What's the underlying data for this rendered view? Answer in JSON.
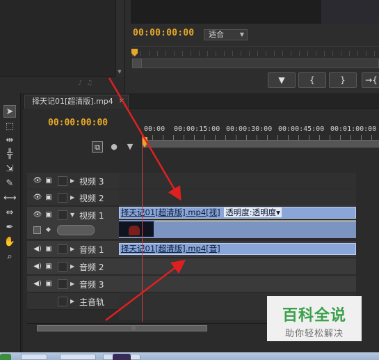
{
  "program_monitor": {
    "timecode": "00:00:00:00",
    "fit_label": "适合",
    "buttons": [
      "▼",
      "{",
      "}",
      "→{"
    ]
  },
  "timeline": {
    "tab_title": "择天记01[超清版].mp4",
    "timecode": "00:00:00:00",
    "ruler_labels": [
      "00:00",
      "00:00:15:00",
      "00:00:30:00",
      "00:00:45:00",
      "00:01:00:00"
    ],
    "tracks": {
      "video3": "视频 3",
      "video2": "视频 2",
      "video1": "视频 1",
      "audio1": "音频 1",
      "audio2": "音频 2",
      "audio3": "音频 3",
      "master": "主音轨"
    },
    "video_clip": {
      "name": "择天记01[超清版].mp4",
      "suffix": "[视]",
      "effect": "透明度:透明度"
    },
    "audio_clip": {
      "name": "择天记01[超清版].mp4",
      "suffix": "[音]"
    }
  },
  "watermark": {
    "title": "百科全说",
    "subtitle": "助你轻松解决"
  },
  "colors": {
    "timecode": "#e8a827",
    "clip": "#8aa6d8",
    "playhead": "#d04040",
    "arrow": "#e02020",
    "watermark_green": "#3aa04b"
  }
}
